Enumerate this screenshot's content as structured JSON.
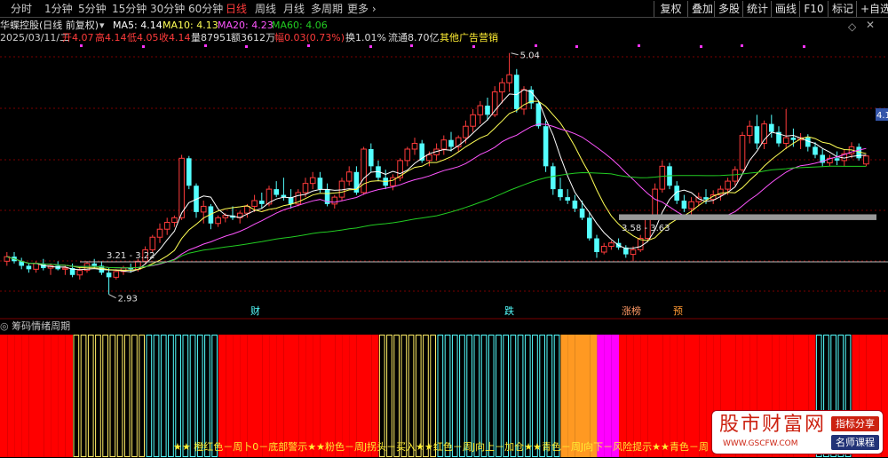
{
  "toolbar": {
    "periods": [
      "分时",
      "1分钟",
      "5分钟",
      "15分钟",
      "30分钟",
      "60分钟",
      "日线",
      "周线",
      "月线",
      "多周期",
      "更多"
    ],
    "active_period": "日线",
    "right_buttons": [
      "复权",
      "叠加",
      "多股",
      "统计",
      "画线",
      "F10",
      "标记",
      "+自选"
    ],
    "more_arrow": "›"
  },
  "stock": {
    "name": "华蝶控股(日线 前复权)",
    "ma5_label": "MA5: 4.14",
    "ma10_label": "MA10: 4.13",
    "ma20_label": "MA20: 4.23",
    "ma60_label": "MA60: 4.06",
    "date": "2025/03/11/二",
    "open": "开4.07",
    "high": "高4.14",
    "low": "低4.05",
    "close": "收4.14",
    "volume": "量87951",
    "amount": "额3612万",
    "change": "幅0.03(0.73%)",
    "turnover": "换1.01%",
    "float_cap": "流通8.70亿",
    "ad_text": "其他广告营销"
  },
  "colors": {
    "up": "#ff3b3b",
    "down": "#54ffff",
    "ma5": "#ffffff",
    "ma10": "#ffff55",
    "ma20": "#ff55ff",
    "ma60": "#22cc22",
    "bar_red": "#ff0000",
    "bar_cyan": "#54ffff",
    "bar_yellow": "#ffee66",
    "bar_orange": "#ff9922",
    "bar_magenta": "#ff00ff"
  },
  "annotations": {
    "high_label": "5.04",
    "low_label": "2.93",
    "range1": "3.21 - 3.22",
    "range2": "3.58 - 3.63",
    "price_tag": "4.1",
    "markers": [
      "财",
      "跌",
      "涨榜",
      "预"
    ]
  },
  "chart_data": {
    "type": "candlestick",
    "ylim": [
      2.85,
      5.1
    ],
    "candles": [
      [
        3.22,
        3.3,
        3.18,
        3.26
      ],
      [
        3.26,
        3.3,
        3.2,
        3.22
      ],
      [
        3.22,
        3.25,
        3.15,
        3.18
      ],
      [
        3.18,
        3.2,
        3.12,
        3.15
      ],
      [
        3.15,
        3.22,
        3.12,
        3.2
      ],
      [
        3.2,
        3.24,
        3.14,
        3.16
      ],
      [
        3.16,
        3.2,
        3.1,
        3.18
      ],
      [
        3.18,
        3.22,
        3.14,
        3.15
      ],
      [
        3.15,
        3.18,
        3.1,
        3.16
      ],
      [
        3.16,
        3.2,
        3.08,
        3.1
      ],
      [
        3.1,
        3.16,
        3.06,
        3.14
      ],
      [
        3.14,
        3.22,
        3.12,
        3.2
      ],
      [
        3.2,
        3.24,
        3.16,
        3.18
      ],
      [
        3.18,
        3.22,
        3.1,
        3.12
      ],
      [
        3.12,
        3.16,
        2.93,
        3.08
      ],
      [
        3.08,
        3.15,
        3.06,
        3.13
      ],
      [
        3.13,
        3.18,
        3.1,
        3.16
      ],
      [
        3.16,
        3.2,
        3.12,
        3.15
      ],
      [
        3.15,
        3.24,
        3.13,
        3.22
      ],
      [
        3.22,
        3.35,
        3.2,
        3.32
      ],
      [
        3.32,
        3.45,
        3.3,
        3.43
      ],
      [
        3.43,
        3.55,
        3.38,
        3.5
      ],
      [
        3.5,
        3.6,
        3.45,
        3.56
      ],
      [
        3.56,
        3.62,
        3.52,
        3.6
      ],
      [
        3.6,
        4.15,
        3.58,
        4.12
      ],
      [
        4.12,
        4.14,
        3.85,
        3.88
      ],
      [
        3.88,
        3.9,
        3.6,
        3.65
      ],
      [
        3.65,
        3.75,
        3.55,
        3.7
      ],
      [
        3.7,
        3.72,
        3.5,
        3.55
      ],
      [
        3.55,
        3.62,
        3.52,
        3.6
      ],
      [
        3.6,
        3.64,
        3.56,
        3.62
      ],
      [
        3.62,
        3.7,
        3.58,
        3.6
      ],
      [
        3.6,
        3.66,
        3.55,
        3.64
      ],
      [
        3.64,
        3.72,
        3.6,
        3.7
      ],
      [
        3.7,
        3.8,
        3.65,
        3.75
      ],
      [
        3.75,
        3.82,
        3.68,
        3.72
      ],
      [
        3.72,
        3.88,
        3.7,
        3.85
      ],
      [
        3.85,
        3.92,
        3.78,
        3.8
      ],
      [
        3.8,
        3.95,
        3.75,
        3.78
      ],
      [
        3.78,
        3.85,
        3.68,
        3.72
      ],
      [
        3.72,
        3.85,
        3.7,
        3.82
      ],
      [
        3.82,
        3.95,
        3.78,
        3.9
      ],
      [
        3.9,
        4.0,
        3.85,
        3.95
      ],
      [
        3.95,
        4.0,
        3.82,
        3.85
      ],
      [
        3.85,
        3.9,
        3.7,
        3.72
      ],
      [
        3.72,
        3.8,
        3.68,
        3.78
      ],
      [
        3.78,
        3.95,
        3.75,
        3.92
      ],
      [
        3.92,
        4.05,
        3.88,
        4.0
      ],
      [
        4.0,
        4.05,
        3.8,
        3.82
      ],
      [
        3.82,
        4.22,
        3.8,
        4.2
      ],
      [
        4.2,
        4.25,
        4.0,
        4.05
      ],
      [
        4.05,
        4.1,
        3.92,
        3.95
      ],
      [
        3.95,
        4.02,
        3.85,
        3.88
      ],
      [
        3.88,
        3.98,
        3.84,
        3.95
      ],
      [
        3.95,
        4.12,
        3.92,
        4.1
      ],
      [
        4.1,
        4.22,
        4.05,
        4.2
      ],
      [
        4.2,
        4.3,
        4.15,
        4.25
      ],
      [
        4.25,
        4.28,
        4.08,
        4.1
      ],
      [
        4.1,
        4.18,
        4.05,
        4.15
      ],
      [
        4.15,
        4.25,
        4.1,
        4.2
      ],
      [
        4.2,
        4.32,
        4.15,
        4.28
      ],
      [
        4.28,
        4.35,
        4.18,
        4.22
      ],
      [
        4.22,
        4.32,
        4.18,
        4.3
      ],
      [
        4.3,
        4.45,
        4.25,
        4.4
      ],
      [
        4.4,
        4.55,
        4.35,
        4.5
      ],
      [
        4.5,
        4.62,
        4.42,
        4.58
      ],
      [
        4.58,
        4.65,
        4.45,
        4.5
      ],
      [
        4.5,
        4.75,
        4.48,
        4.7
      ],
      [
        4.7,
        4.82,
        4.6,
        4.78
      ],
      [
        4.78,
        5.04,
        4.7,
        4.85
      ],
      [
        4.85,
        4.9,
        4.52,
        4.55
      ],
      [
        4.55,
        4.75,
        4.5,
        4.72
      ],
      [
        4.72,
        4.75,
        4.55,
        4.6
      ],
      [
        4.6,
        4.62,
        4.38,
        4.4
      ],
      [
        4.4,
        4.45,
        4.0,
        4.05
      ],
      [
        4.05,
        4.08,
        3.8,
        3.85
      ],
      [
        3.85,
        3.95,
        3.75,
        3.78
      ],
      [
        3.78,
        3.85,
        3.72,
        3.75
      ],
      [
        3.75,
        3.8,
        3.65,
        3.68
      ],
      [
        3.68,
        3.75,
        3.58,
        3.6
      ],
      [
        3.6,
        3.65,
        3.4,
        3.42
      ],
      [
        3.42,
        3.45,
        3.25,
        3.3
      ],
      [
        3.3,
        3.38,
        3.28,
        3.35
      ],
      [
        3.35,
        3.4,
        3.32,
        3.38
      ],
      [
        3.38,
        3.42,
        3.32,
        3.34
      ],
      [
        3.34,
        3.36,
        3.25,
        3.28
      ],
      [
        3.28,
        3.35,
        3.22,
        3.32
      ],
      [
        3.32,
        3.45,
        3.3,
        3.42
      ],
      [
        3.42,
        3.62,
        3.4,
        3.6
      ],
      [
        3.6,
        3.9,
        3.58,
        3.85
      ],
      [
        3.85,
        4.1,
        3.82,
        4.05
      ],
      [
        4.05,
        4.08,
        3.85,
        3.88
      ],
      [
        3.88,
        3.92,
        3.72,
        3.75
      ],
      [
        3.75,
        3.8,
        3.65,
        3.68
      ],
      [
        3.68,
        3.78,
        3.62,
        3.74
      ],
      [
        3.74,
        3.82,
        3.7,
        3.78
      ],
      [
        3.78,
        3.85,
        3.72,
        3.76
      ],
      [
        3.76,
        3.84,
        3.72,
        3.8
      ],
      [
        3.8,
        3.88,
        3.75,
        3.85
      ],
      [
        3.85,
        3.95,
        3.8,
        3.92
      ],
      [
        3.92,
        4.05,
        3.88,
        4.02
      ],
      [
        4.02,
        4.35,
        4.0,
        4.32
      ],
      [
        4.32,
        4.45,
        4.25,
        4.4
      ],
      [
        4.4,
        4.5,
        4.2,
        4.25
      ],
      [
        4.25,
        4.45,
        4.2,
        4.42
      ],
      [
        4.42,
        4.5,
        4.3,
        4.35
      ],
      [
        4.35,
        4.4,
        4.22,
        4.25
      ],
      [
        4.25,
        4.55,
        4.2,
        4.3
      ],
      [
        4.3,
        4.38,
        4.22,
        4.28
      ],
      [
        4.28,
        4.34,
        4.2,
        4.3
      ],
      [
        4.3,
        4.33,
        4.18,
        4.22
      ],
      [
        4.22,
        4.26,
        4.12,
        4.15
      ],
      [
        4.15,
        4.2,
        4.05,
        4.08
      ],
      [
        4.08,
        4.15,
        4.05,
        4.12
      ],
      [
        4.12,
        4.18,
        4.06,
        4.1
      ],
      [
        4.1,
        4.2,
        4.05,
        4.16
      ],
      [
        4.16,
        4.26,
        4.12,
        4.22
      ],
      [
        4.22,
        4.25,
        4.1,
        4.12
      ],
      [
        4.07,
        4.14,
        4.05,
        4.14
      ]
    ],
    "emotion_cycle": [
      "red",
      "red",
      "red",
      "red",
      "red",
      "red",
      "red",
      "red",
      "red",
      "red",
      "yellow",
      "yellow",
      "yellow",
      "yellow",
      "yellow",
      "yellow",
      "yellow",
      "yellow",
      "yellow",
      "yellow",
      "cyan",
      "cyan",
      "cyan",
      "cyan",
      "cyan",
      "cyan",
      "cyan",
      "cyan",
      "cyan",
      "cyan",
      "red",
      "red",
      "red",
      "red",
      "red",
      "red",
      "red",
      "red",
      "red",
      "red",
      "red",
      "red",
      "red",
      "red",
      "red",
      "red",
      "red",
      "red",
      "red",
      "red",
      "red",
      "red",
      "yellow",
      "yellow",
      "yellow",
      "yellow",
      "yellow",
      "yellow",
      "yellow",
      "yellow",
      "cyan",
      "cyan",
      "cyan",
      "cyan",
      "cyan",
      "cyan",
      "cyan",
      "cyan",
      "cyan",
      "cyan",
      "cyan",
      "cyan",
      "cyan",
      "cyan",
      "cyan",
      "cyan",
      "cyan",
      "orange",
      "orange",
      "orange",
      "orange",
      "orange",
      "magenta",
      "magenta",
      "magenta",
      "red",
      "red",
      "red",
      "red",
      "red",
      "red",
      "red",
      "red",
      "red",
      "red",
      "red",
      "red",
      "red",
      "red",
      "red",
      "red",
      "red",
      "red",
      "red",
      "red",
      "red",
      "red",
      "red",
      "red",
      "red",
      "red",
      "red",
      "cyan",
      "cyan",
      "cyan",
      "cyan",
      "cyan",
      "red",
      "red",
      "red",
      "red",
      "red",
      "red",
      "cyan"
    ]
  },
  "indicator": {
    "title": "筹码情绪周期",
    "ticker": "★★ 橙红色－周卜0－底部警示★★粉色－周J拐头－买入★★红色－周J向上－加仓★★青色－周J向下－风险提示★★青色－周"
  },
  "watermark": {
    "title": "股市财富网",
    "url": "WWW.GSCFW.COM",
    "tag1": "指标分享",
    "tag2": "名师课程"
  }
}
